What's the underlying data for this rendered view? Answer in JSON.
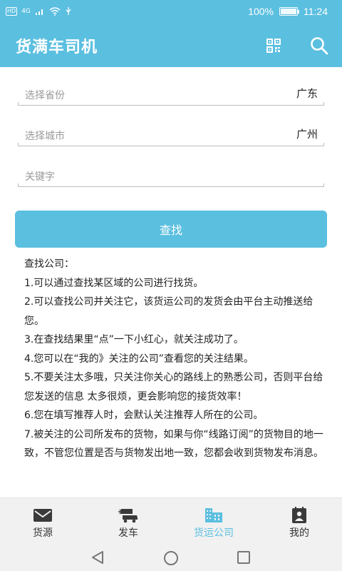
{
  "status_bar": {
    "hd": "HD",
    "network": "4G",
    "battery_percent": "100%",
    "battery_level": 1.0,
    "time": "11:24"
  },
  "app_bar": {
    "title": "货满车司机",
    "icons": [
      "qr-code-icon",
      "search-icon"
    ]
  },
  "form": {
    "province": {
      "placeholder": "选择省份",
      "value": "广东"
    },
    "city": {
      "placeholder": "选择城市",
      "value": "广州"
    },
    "keyword": {
      "placeholder": "关键字",
      "value": ""
    },
    "search_button": "查找"
  },
  "help": {
    "title": "查找公司：",
    "lines": [
      "1.可以通过查找某区域的公司进行找货。",
      "2.可以查找公司并关注它，该货运公司的发货会由平台主动推送给您。",
      "3.在查找结果里“点”一下小红心，就关注成功了。",
      "4.您可以在“我的》关注的公司”查看您的关注结果。",
      "5.不要关注太多哦，只关注你关心的路线上的熟悉公司，否则平台给您发送的信息 太多很烦，更会影响您的接货效率！",
      "6.您在填写推荐人时，会默认关注推荐人所在的公司。",
      "7.被关注的公司所发布的货物，如果与你“线路订阅”的货物目的地一致，不管您位置是否与货物发出地一致，您都会收到货物发布消息。"
    ]
  },
  "bottom_nav": {
    "items": [
      {
        "label": "货源",
        "icon": "mail-icon",
        "active": false
      },
      {
        "label": "发车",
        "icon": "truck-icon",
        "active": false
      },
      {
        "label": "货运公司",
        "icon": "building-icon",
        "active": true
      },
      {
        "label": "我的",
        "icon": "contact-icon",
        "active": false
      }
    ]
  },
  "colors": {
    "primary": "#5bbfe0",
    "nav_bg": "#f1f1f1",
    "icon_dark": "#3a3a3a"
  }
}
